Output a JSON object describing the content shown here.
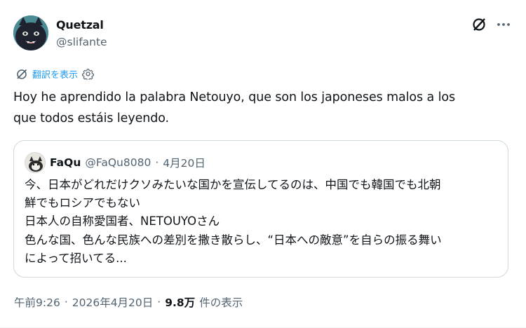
{
  "author": {
    "display_name": "Quetzal",
    "handle": "@slifante"
  },
  "top_icons": {
    "grok_icon": "grok-slash-circle",
    "more_icon": "more-dots"
  },
  "translate": {
    "label": "翻訳を表示"
  },
  "tweet": {
    "text": "Hoy he aprendido la palabra Netouyo, que son los japoneses malos a los\nque todos estáis leyendo."
  },
  "quote": {
    "display_name": "FaQu",
    "handle": "@FaQu8080",
    "separator": "·",
    "date": "4月20日",
    "text": "今、日本がどれだけクソみたいな国かを宣伝してるのは、中国でも韓国でも北朝\n鮮でもロシアでもない\n日本人の自称愛国者、NETOUYOさん\n色んな国、色んな民族への差別を撒き散らし、“日本への敵意”を自らの振る舞い\nによって招いてる..."
  },
  "meta": {
    "time": "午前9:26",
    "separator1": "·",
    "date": "2026年4月20日",
    "separator2": "·",
    "views_count": "9.8万",
    "views_label": "件の表示"
  },
  "colors": {
    "link": "#1d9bf0",
    "secondary_text": "#536471",
    "border": "#cfd9de"
  }
}
